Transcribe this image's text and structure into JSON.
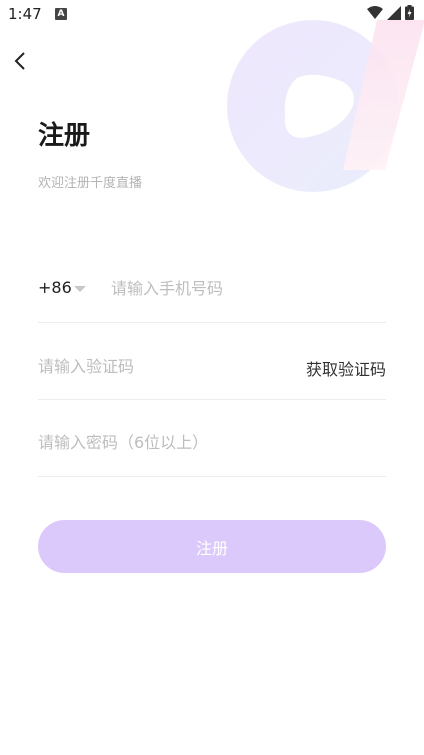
{
  "status_bar": {
    "time": "1:47",
    "notification_badge": "A"
  },
  "header": {
    "title": "注册",
    "subtitle": "欢迎注册千度直播"
  },
  "form": {
    "country_code": "+86",
    "phone_placeholder": "请输入手机号码",
    "code_placeholder": "请输入验证码",
    "get_code_label": "获取验证码",
    "password_placeholder": "请输入密码（6位以上）",
    "submit_label": "注册"
  },
  "colors": {
    "accent_button": "#dcc9fb",
    "placeholder": "#bdbdbd",
    "divider": "#ececec"
  }
}
